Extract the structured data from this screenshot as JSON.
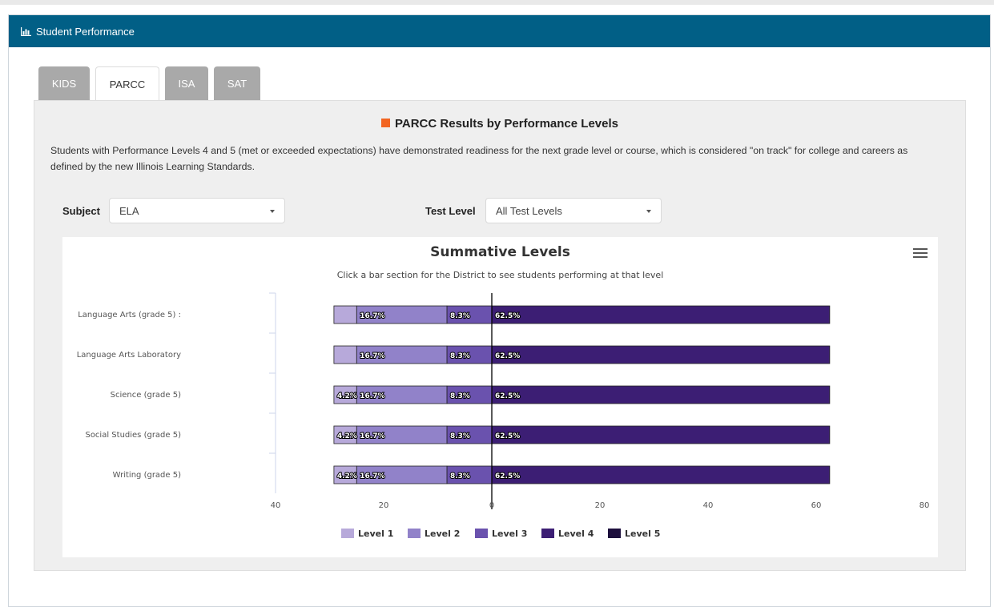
{
  "header": {
    "title": "Student Performance",
    "icon": "bar-chart-icon"
  },
  "tabs": [
    {
      "label": "KIDS",
      "active": false
    },
    {
      "label": "PARCC",
      "active": true
    },
    {
      "label": "ISA",
      "active": false
    },
    {
      "label": "SAT",
      "active": false
    }
  ],
  "section": {
    "title": "PARCC Results by Performance Levels",
    "description": "Students with Performance Levels 4 and 5 (met or exceeded expectations) have demonstrated readiness for the next grade level or course, which is considered \"on track\" for college and careers as defined by the new Illinois Learning Standards."
  },
  "filters": {
    "subject_label": "Subject",
    "subject_value": "ELA",
    "test_level_label": "Test Level",
    "test_level_value": "All Test Levels"
  },
  "chart_data": {
    "type": "bar",
    "orientation": "horizontal-stacked-diverging",
    "title": "Summative Levels",
    "subtitle": "Click a bar section for the District to see students performing at that level",
    "categories": [
      "Language Arts (grade 5) :",
      "Language Arts Laboratory",
      "Science (grade 5)",
      "Social Studies (grade 5)",
      "Writing (grade 5)"
    ],
    "series": [
      {
        "name": "Level 1",
        "color": "#b7a9da",
        "values": [
          -4.2,
          -4.2,
          -4.2,
          -4.2,
          -4.2
        ],
        "labels": [
          "",
          "",
          "4.2%",
          "4.2%",
          "4.2%"
        ]
      },
      {
        "name": "Level 2",
        "color": "#9182c9",
        "values": [
          -16.7,
          -16.7,
          -16.7,
          -16.7,
          -16.7
        ],
        "labels": [
          "16.7%",
          "16.7%",
          "16.7%",
          "16.7%",
          "16.7%"
        ]
      },
      {
        "name": "Level 3",
        "color": "#6a52ae",
        "values": [
          -8.3,
          -8.3,
          -8.3,
          -8.3,
          -8.3
        ],
        "labels": [
          "8.3%",
          "8.3%",
          "8.3%",
          "8.3%",
          "8.3%"
        ]
      },
      {
        "name": "Level 4",
        "color": "#3c1e74",
        "values": [
          62.5,
          62.5,
          62.5,
          62.5,
          62.5
        ],
        "labels": [
          "62.5%",
          "62.5%",
          "62.5%",
          "62.5%",
          "62.5%"
        ]
      },
      {
        "name": "Level 5",
        "color": "#1d0f3d",
        "values": [
          0,
          0,
          0,
          0,
          0
        ],
        "labels": [
          "",
          "",
          "",
          "",
          ""
        ]
      }
    ],
    "xlim": [
      -40,
      80
    ],
    "xticks": [
      -40,
      -20,
      0,
      20,
      40,
      60,
      80
    ],
    "xtick_labels": [
      "40",
      "20",
      "0",
      "20",
      "40",
      "60",
      "80"
    ],
    "legend_position": "bottom"
  }
}
